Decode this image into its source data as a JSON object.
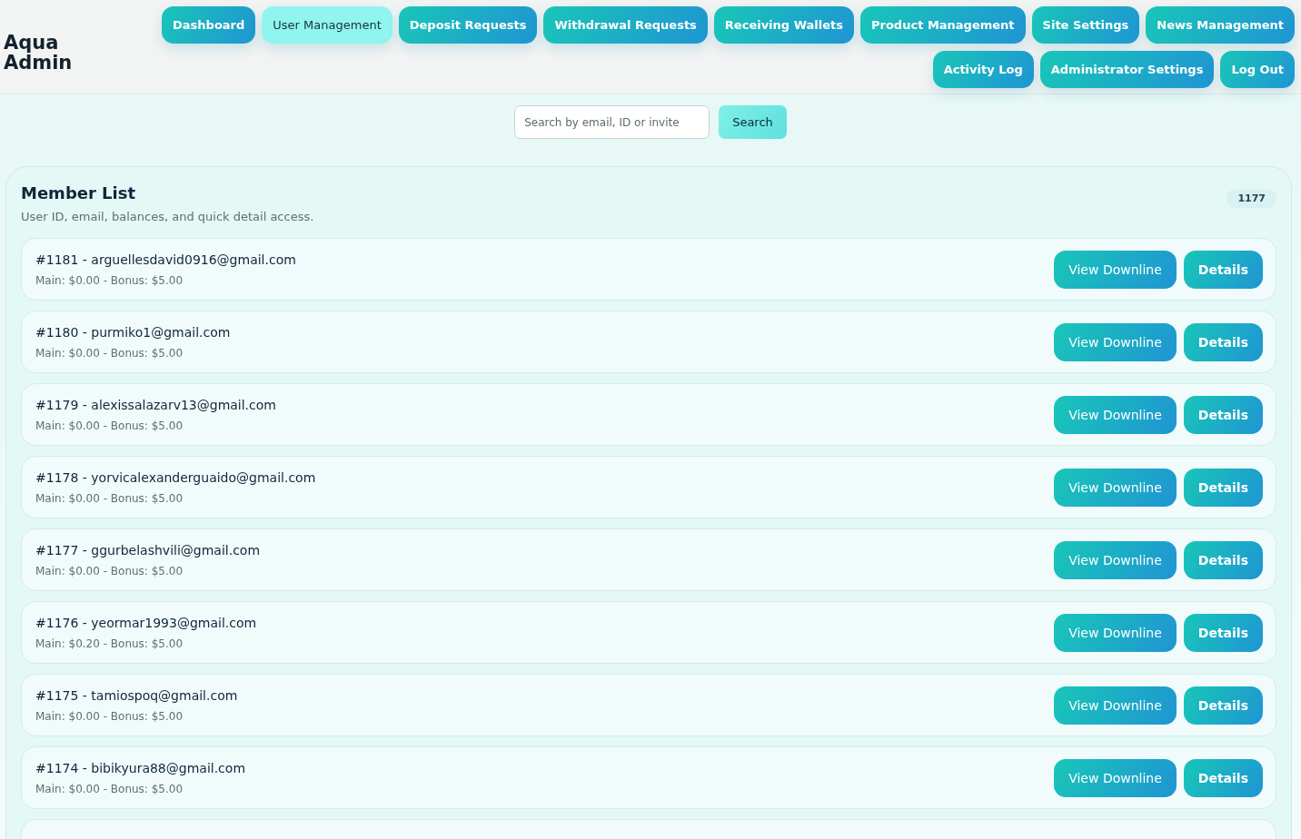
{
  "brand": {
    "line1": "Aqua",
    "line2": "Admin"
  },
  "nav": [
    {
      "label": "Dashboard",
      "selected": false
    },
    {
      "label": "User Management",
      "selected": true
    },
    {
      "label": "Deposit Requests",
      "selected": false
    },
    {
      "label": "Withdrawal Requests",
      "selected": false
    },
    {
      "label": "Receiving Wallets",
      "selected": false
    },
    {
      "label": "Product Management",
      "selected": false
    },
    {
      "label": "Site Settings",
      "selected": false
    },
    {
      "label": "News Management",
      "selected": false
    },
    {
      "label": "Activity Log",
      "selected": false
    },
    {
      "label": "Administrator Settings",
      "selected": false
    },
    {
      "label": "Log Out",
      "selected": false
    }
  ],
  "search": {
    "placeholder": "Search by email, ID or invite",
    "button": "Search"
  },
  "member_list": {
    "title": "Member List",
    "subtitle": "User ID, email, balances, and quick detail access.",
    "count": "1177",
    "rows": [
      {
        "title": "#1181 - arguellesdavid0916@gmail.com",
        "balances": "Main: $0.00 - Bonus: $5.00",
        "actions": [
          "View Downline",
          "Details"
        ]
      },
      {
        "title": "#1180 - purmiko1@gmail.com",
        "balances": "Main: $0.00 - Bonus: $5.00",
        "actions": [
          "View Downline",
          "Details"
        ]
      },
      {
        "title": "#1179 - alexissalazarv13@gmail.com",
        "balances": "Main: $0.00 - Bonus: $5.00",
        "actions": [
          "View Downline",
          "Details"
        ]
      },
      {
        "title": "#1178 - yorvicalexanderguaido@gmail.com",
        "balances": "Main: $0.00 - Bonus: $5.00",
        "actions": [
          "View Downline",
          "Details"
        ]
      },
      {
        "title": "#1177 - ggurbelashvili@gmail.com",
        "balances": "Main: $0.00 - Bonus: $5.00",
        "actions": [
          "View Downline",
          "Details"
        ]
      },
      {
        "title": "#1176 - yeormar1993@gmail.com",
        "balances": "Main: $0.20 - Bonus: $5.00",
        "actions": [
          "View Downline",
          "Details"
        ]
      },
      {
        "title": "#1175 - tamiospoq@gmail.com",
        "balances": "Main: $0.00 - Bonus: $5.00",
        "actions": [
          "View Downline",
          "Details"
        ]
      },
      {
        "title": "#1174 - bibikyura88@gmail.com",
        "balances": "Main: $0.00 - Bonus: $5.00",
        "actions": [
          "View Downline",
          "Details"
        ]
      }
    ]
  }
}
